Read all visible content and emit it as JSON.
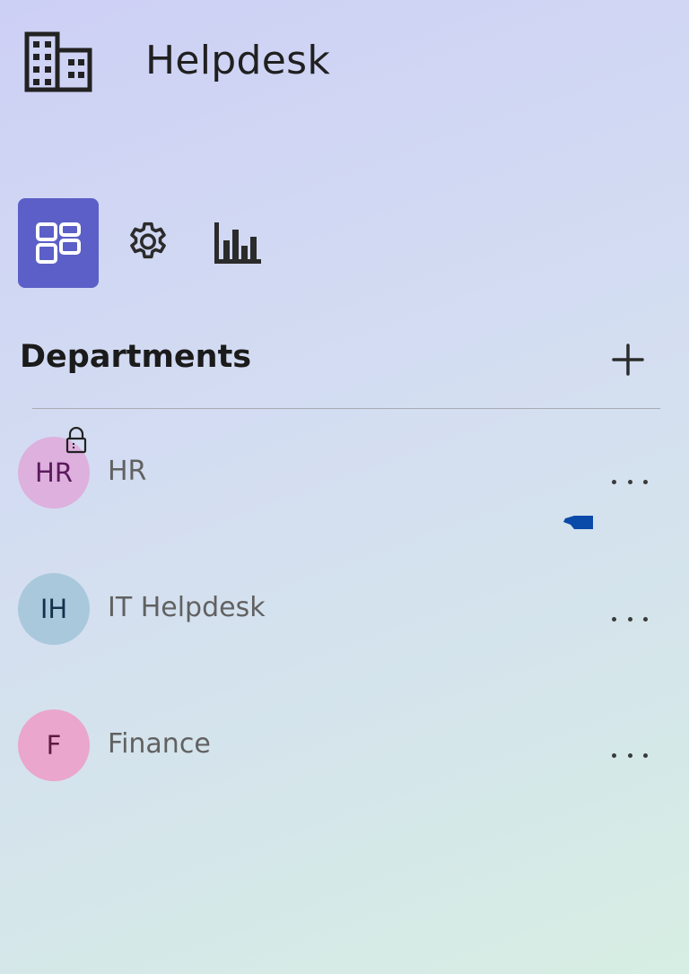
{
  "app": {
    "title": "Helpdesk",
    "logo_icon": "building-icon"
  },
  "nav": {
    "items": [
      {
        "id": "dashboard",
        "icon": "dashboard-icon",
        "active": true
      },
      {
        "id": "settings",
        "icon": "gear-icon",
        "active": false
      },
      {
        "id": "reports",
        "icon": "bar-chart-icon",
        "active": false
      }
    ],
    "active_color": "#5b5fc7"
  },
  "departments": {
    "title": "Departments",
    "add_icon": "plus-icon",
    "items": [
      {
        "initials": "HR",
        "name": "HR",
        "avatar_bg": "#ddb0dd",
        "avatar_fg": "#5c1a5e",
        "locked": true
      },
      {
        "initials": "IH",
        "name": "IT Helpdesk",
        "avatar_bg": "#a9c8dc",
        "avatar_fg": "#14314d",
        "locked": false
      },
      {
        "initials": "F",
        "name": "Finance",
        "avatar_bg": "#eaa6cd",
        "avatar_fg": "#5e1a45",
        "locked": false
      }
    ]
  }
}
